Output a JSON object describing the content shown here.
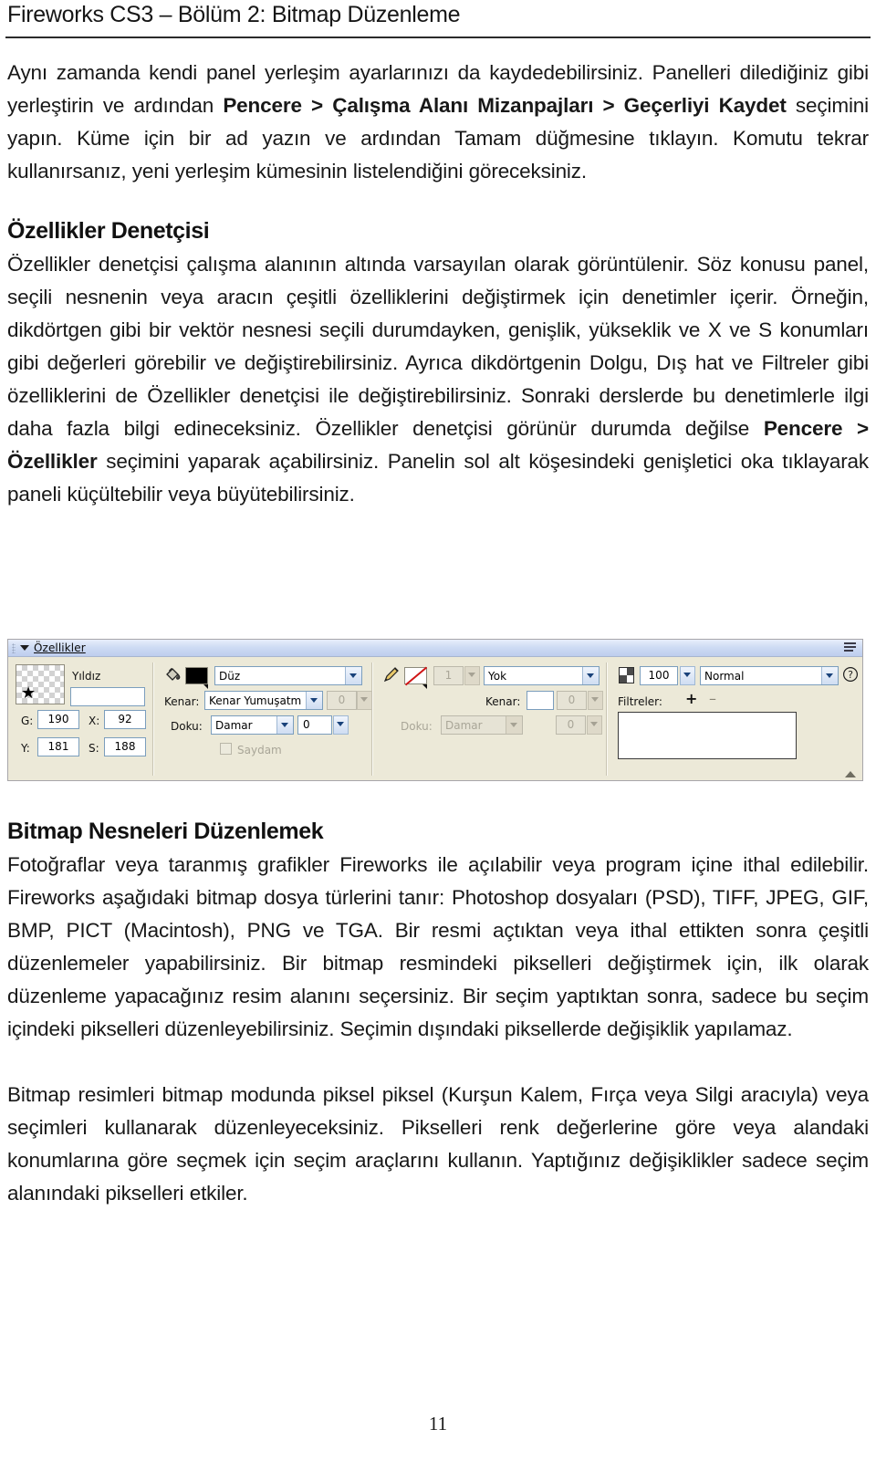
{
  "header": {
    "title": "Fireworks CS3 – Bölüm 2: Bitmap Düzenleme"
  },
  "content": {
    "para1_a": "Aynı zamanda kendi panel yerleşim ayarlarınızı da kaydedebilirsiniz. Panelleri dilediğiniz gibi yerleştirin ve ardından ",
    "para1_b": "Pencere > Çalışma Alanı Mizanpajları > Geçerliyi Kaydet",
    "para1_c": " seçimini yapın. Küme için bir ad yazın ve ardından Tamam düğmesine tıklayın. Komutu tekrar kullanırsanız, yeni yerleşim kümesinin listelendiğini göreceksiniz.",
    "heading1": "Özellikler Denetçisi",
    "para2_a": "Özellikler denetçisi çalışma alanının altında varsayılan olarak görüntülenir. Söz konusu panel, seçili nesnenin veya aracın çeşitli özelliklerini değiştirmek için denetimler içerir. Örneğin, dikdörtgen gibi bir vektör nesnesi seçili durumdayken, genişlik, yükseklik ve X ve S konumları gibi değerleri görebilir ve değiştirebilirsiniz. Ayrıca dikdörtgenin Dolgu, Dış hat ve Filtreler gibi özelliklerini de Özellikler denetçisi ile değiştirebilirsiniz. Sonraki derslerde bu denetimlerle ilgi daha fazla bilgi edineceksiniz. Özellikler denetçisi görünür durumda değilse ",
    "para2_b": "Pencere > Özellikler",
    "para2_c": " seçimini yaparak açabilirsiniz. Panelin sol alt köşesindeki genişletici oka tıklayarak paneli küçültebilir veya büyütebilirsiniz.",
    "heading2": "Bitmap Nesneleri Düzenlemek",
    "para3": "Fotoğraflar veya taranmış grafikler Fireworks ile açılabilir veya program içine ithal edilebilir. Fireworks aşağıdaki bitmap dosya türlerini tanır: Photoshop dosyaları (PSD), TIFF, JPEG, GIF, BMP, PICT (Macintosh), PNG ve TGA. Bir resmi açtıktan veya ithal ettikten sonra çeşitli düzenlemeler yapabilirsiniz. Bir bitmap resmindeki pikselleri değiştirmek için, ilk olarak düzenleme yapacağınız resim alanını seçersiniz. Bir seçim yaptıktan sonra, sadece bu seçim içindeki pikselleri düzenleyebilirsiniz. Seçimin dışındaki piksellerde değişiklik yapılamaz.",
    "para4": "Bitmap resimleri bitmap modunda piksel piksel (Kurşun Kalem, Fırça veya Silgi aracıyla) veya seçimleri kullanarak düzenleyeceksiniz. Pikselleri renk değerlerine göre veya alandaki konumlarına göre seçmek için seçim araçlarını kullanın. Yaptığınız değişiklikler sadece seçim alanındaki pikselleri etkiler."
  },
  "properties_panel": {
    "title": "Özellikler",
    "object_name": "Yıldız",
    "object_name_field": "",
    "dimensions": {
      "width_label": "G:",
      "width_value": "190",
      "x_label": "X:",
      "x_value": "92",
      "height_label": "Y:",
      "height_value": "181",
      "y_label": "S:",
      "y_value": "188"
    },
    "fill": {
      "swatch_color": "#000000",
      "type": "Düz",
      "edge_label": "Kenar:",
      "edge_value": "Kenar Yumuşatm",
      "edge_amount": "0",
      "texture_label": "Doku:",
      "texture_value": "Damar",
      "texture_amount": "0",
      "transparent_label": "Saydam"
    },
    "stroke": {
      "swatch": "none",
      "size": "1",
      "type": "Yok",
      "edge_label": "Kenar:",
      "edge_value": "",
      "edge_amount": "0",
      "texture_label": "Doku:",
      "texture_value": "Damar",
      "texture_amount": "0"
    },
    "blend": {
      "opacity": "100",
      "mode": "Normal",
      "filters_label": "Filtreler:",
      "add_label": "+",
      "remove_label": "–",
      "help_label": "?"
    }
  },
  "footer": {
    "page_number": "11"
  },
  "colors": {
    "panel_bg": "#ece9d8",
    "titlebar_top": "#e8eefb",
    "titlebar_bottom": "#bdcdee",
    "field_border": "#7b9ebd",
    "text": "#181818"
  }
}
